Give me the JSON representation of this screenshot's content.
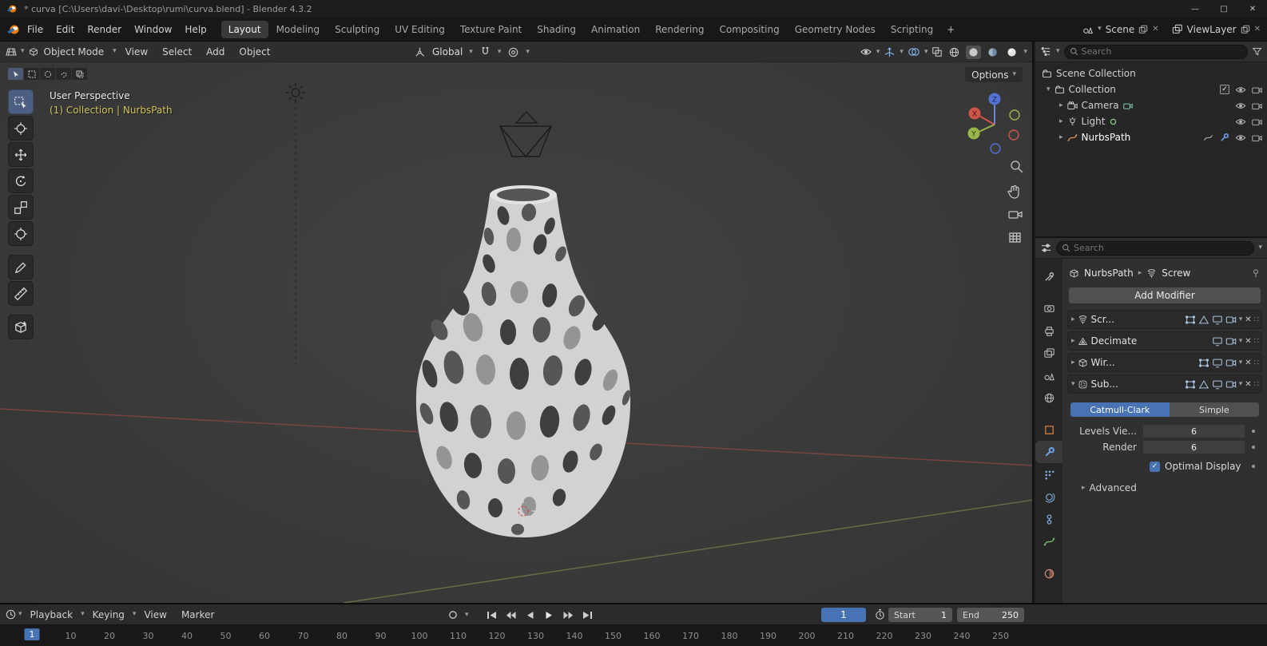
{
  "icons": {
    "chevron_down": "▾",
    "chevron_right": "▸",
    "close": "✕",
    "minimize": "—",
    "maximize": "□",
    "check": "✓",
    "grip": "∷",
    "plus": "+"
  },
  "titlebar": {
    "title": "* curva [C:\\Users\\davi-\\Desktop\\rumi\\curva.blend] - Blender 4.3.2"
  },
  "menubar": {
    "menus": [
      "File",
      "Edit",
      "Render",
      "Window",
      "Help"
    ],
    "workspaces": [
      "Layout",
      "Modeling",
      "Sculpting",
      "UV Editing",
      "Texture Paint",
      "Shading",
      "Animation",
      "Rendering",
      "Compositing",
      "Geometry Nodes",
      "Scripting"
    ],
    "active_workspace": "Layout",
    "scene": {
      "label": "Scene"
    },
    "viewlayer": {
      "label": "ViewLayer"
    }
  },
  "viewport_header": {
    "mode": "Object Mode",
    "menus": [
      "View",
      "Select",
      "Add",
      "Object"
    ],
    "orientation": "Global"
  },
  "viewport": {
    "overlay": {
      "perspective": "User Perspective",
      "context": "(1) Collection | NurbsPath"
    },
    "options_label": "Options",
    "gizmo": {
      "x": "X",
      "y": "Y",
      "z": "Z"
    }
  },
  "outliner": {
    "search_placeholder": "Search",
    "items": [
      "Scene Collection",
      "Collection",
      "Camera",
      "Light",
      "NurbsPath"
    ]
  },
  "properties": {
    "search_placeholder": "Search",
    "breadcrumb": {
      "object": "NurbsPath",
      "modifier": "Screw"
    },
    "add_modifier_label": "Add Modifier",
    "modifiers": [
      "Scr...",
      "Decimate",
      "Wir...",
      "Sub..."
    ],
    "subdivision": {
      "mode_catmull": "Catmull-Clark",
      "mode_simple": "Simple",
      "levels_label": "Levels Vie...",
      "levels_value": "6",
      "render_label": "Render",
      "render_value": "6",
      "optimal_label": "Optimal Display",
      "advanced_label": "Advanced"
    }
  },
  "timeline": {
    "menus": [
      "Playback",
      "Keying",
      "View",
      "Marker"
    ],
    "frame_current": "1",
    "start_label": "Start",
    "start_value": "1",
    "end_label": "End",
    "end_value": "250",
    "ticks": [
      "1",
      "10",
      "20",
      "30",
      "40",
      "50",
      "60",
      "70",
      "80",
      "90",
      "100",
      "110",
      "120",
      "130",
      "140",
      "150",
      "160",
      "170",
      "180",
      "190",
      "200",
      "210",
      "220",
      "230",
      "240",
      "250"
    ]
  }
}
